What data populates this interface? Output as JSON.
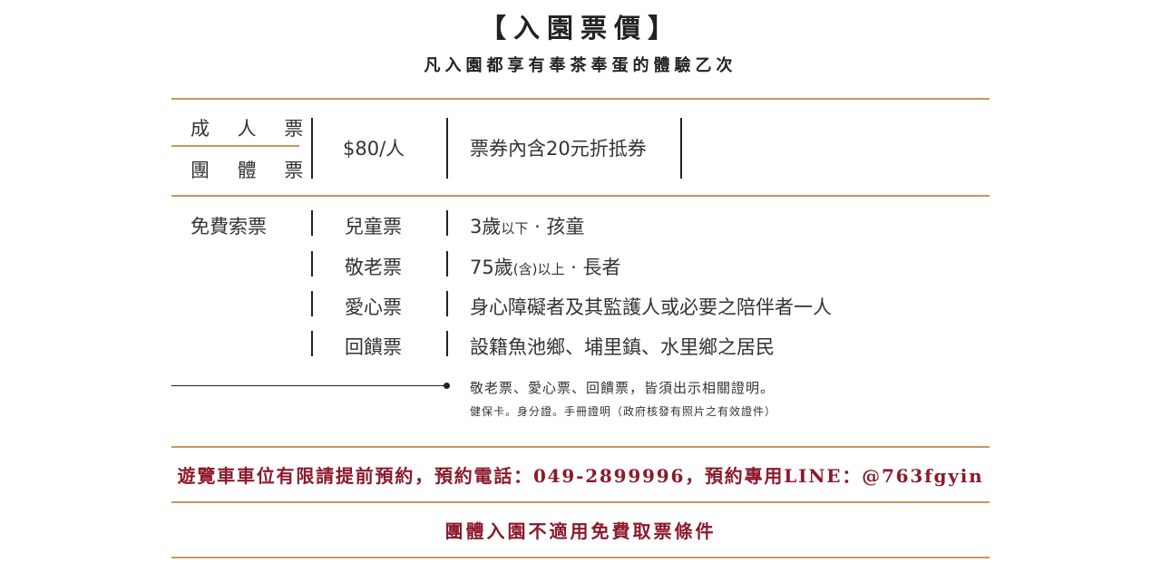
{
  "header": {
    "title": "【入園票價】",
    "subtitle": "凡入園都享有奉茶奉蛋的體驗乙次"
  },
  "paid": {
    "adult_label": "成 人 票",
    "group_label": "團 體 票",
    "price": "$80/人",
    "note": "票券內含20元折抵券"
  },
  "free": {
    "label": "免費索票",
    "rows": [
      {
        "name": "兒童票",
        "main": "3歲",
        "small": "以下",
        "tail": " · 孩童"
      },
      {
        "name": "敬老票",
        "main": "75歲",
        "small": "(含)以上",
        "tail": " · 長者"
      },
      {
        "name": "愛心票",
        "main": "身心障礙者及其監護人或必要之陪伴者一人",
        "small": "",
        "tail": ""
      },
      {
        "name": "回饋票",
        "main": "設籍魚池鄉、埔里鎮、水里鄉之居民",
        "small": "",
        "tail": ""
      }
    ]
  },
  "notes": {
    "line1": "敬老票、愛心票、回饋票，皆須出示相關證明。",
    "line2": "健保卡。身分證。手冊證明（政府核發有照片之有效證件）"
  },
  "banners": {
    "reservation": "遊覽車車位有限請提前預約，預約電話：049-2899996，預約專用LINE：@763fgyin",
    "group_notice": "團體入園不適用免費取票條件"
  },
  "colors": {
    "gold_line": "#c8955e",
    "red_text": "#8b1a2b",
    "dark": "#222222"
  }
}
